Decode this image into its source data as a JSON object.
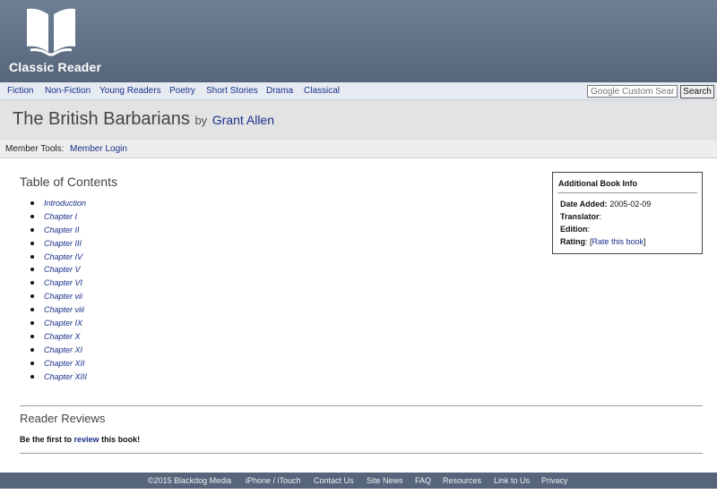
{
  "brand": {
    "name": "Classic Reader",
    "logo_icon": "open-book-icon"
  },
  "nav": {
    "items": [
      "Fiction",
      "Non-Fiction",
      "Young Readers",
      "Poetry",
      "Short Stories",
      "Drama",
      "Classical"
    ],
    "search_placeholder": "Google Custom Search",
    "search_button": "Search"
  },
  "book": {
    "title": "The British Barbarians",
    "by": "by",
    "author": "Grant Allen"
  },
  "member": {
    "label": "Member Tools:",
    "login": "Member Login"
  },
  "toc": {
    "heading": "Table of Contents",
    "items": [
      "Introduction",
      "Chapter I",
      "Chapter II",
      "Chapter III",
      "Chapter IV",
      "Chapter V",
      "Chapter VI",
      "Chapter vii",
      "Chapter viii",
      "Chapter IX",
      "Chapter X",
      "Chapter XI",
      "Chapter XII",
      "Chapter XIII"
    ]
  },
  "info": {
    "title": "Additional Book Info",
    "date_added_label": "Date Added:",
    "date_added_value": "2005-02-09",
    "translator_label": "Translator",
    "translator_sep": ":",
    "edition_label": "Edition",
    "edition_sep": ":",
    "rating_label": "Rating",
    "rating_prefix": ": [",
    "rating_link": "Rate this book",
    "rating_suffix": "]"
  },
  "reviews": {
    "heading": "Reader Reviews",
    "text_before": "Be the first to",
    "link": "review",
    "text_after": "this book!"
  },
  "footer": {
    "items": [
      "©2015 Blackdog Media",
      "iPhone / iTouch",
      "Contact Us",
      "Site News",
      "FAQ",
      "Resources",
      "Link to Us",
      "Privacy"
    ]
  },
  "colors": {
    "header": "#56657a",
    "link": "#1a2f8a",
    "footer": "#56657a"
  }
}
